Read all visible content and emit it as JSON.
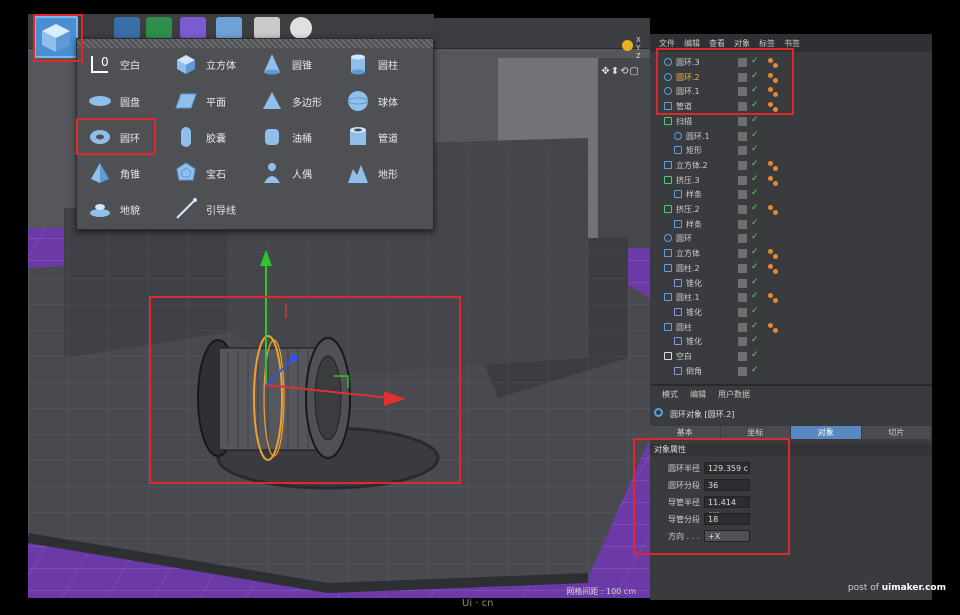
{
  "popup": {
    "items": [
      {
        "label": "空白",
        "icon": "null-icon"
      },
      {
        "label": "立方体",
        "icon": "cube-icon"
      },
      {
        "label": "圆锥",
        "icon": "cone-icon"
      },
      {
        "label": "圆柱",
        "icon": "cylinder-icon"
      },
      {
        "label": "圆盘",
        "icon": "disc-icon"
      },
      {
        "label": "平面",
        "icon": "plane-icon"
      },
      {
        "label": "多边形",
        "icon": "polygon-icon"
      },
      {
        "label": "球体",
        "icon": "sphere-icon"
      },
      {
        "label": "圆环",
        "icon": "torus-icon"
      },
      {
        "label": "胶囊",
        "icon": "capsule-icon"
      },
      {
        "label": "油桶",
        "icon": "oiltank-icon"
      },
      {
        "label": "管道",
        "icon": "tube-icon"
      },
      {
        "label": "角锥",
        "icon": "pyramid-icon"
      },
      {
        "label": "宝石",
        "icon": "platonic-icon"
      },
      {
        "label": "人偶",
        "icon": "figure-icon"
      },
      {
        "label": "地形",
        "icon": "landscape-icon"
      },
      {
        "label": "地貌",
        "icon": "relief-icon"
      },
      {
        "label": "引导线",
        "icon": "guide-icon"
      }
    ]
  },
  "object_manager": {
    "menu": [
      "文件",
      "编辑",
      "查看",
      "对象",
      "标签",
      "书签"
    ],
    "xyz": [
      "X",
      "Y",
      "Z"
    ],
    "rows": [
      {
        "name": "圆环.3",
        "indent": 0,
        "icon": "torus-icon",
        "highlight": false,
        "balls": 1
      },
      {
        "name": "圆环.2",
        "indent": 0,
        "icon": "torus-icon",
        "highlight": true,
        "balls": 1
      },
      {
        "name": "圆环.1",
        "indent": 0,
        "icon": "torus-icon",
        "highlight": false,
        "balls": 1
      },
      {
        "name": "管道",
        "indent": 0,
        "icon": "tube-icon",
        "highlight": false,
        "balls": 1
      },
      {
        "name": "扫描",
        "indent": 0,
        "icon": "sweep-icon",
        "highlight": false,
        "balls": 0
      },
      {
        "name": "圆环.1",
        "indent": 1,
        "icon": "circle-icon",
        "highlight": false,
        "balls": 0
      },
      {
        "name": "矩形",
        "indent": 1,
        "icon": "rectangle-icon",
        "highlight": false,
        "balls": 0
      },
      {
        "name": "立方体.2",
        "indent": 0,
        "icon": "cube-icon",
        "highlight": false,
        "balls": 1
      },
      {
        "name": "挤压.3",
        "indent": 0,
        "icon": "extrude-icon",
        "highlight": false,
        "balls": 1
      },
      {
        "name": "样条",
        "indent": 1,
        "icon": "spline-icon",
        "highlight": false,
        "balls": 0
      },
      {
        "name": "挤压.2",
        "indent": 0,
        "icon": "extrude-icon",
        "highlight": false,
        "balls": 1
      },
      {
        "name": "样条",
        "indent": 1,
        "icon": "spline-icon",
        "highlight": false,
        "balls": 0
      },
      {
        "name": "圆环",
        "indent": 0,
        "icon": "circle-icon",
        "highlight": false,
        "balls": 0
      },
      {
        "name": "立方体",
        "indent": 0,
        "icon": "cube-icon",
        "highlight": false,
        "balls": 1
      },
      {
        "name": "圆柱.2",
        "indent": 0,
        "icon": "cylinder-icon",
        "highlight": false,
        "balls": 1
      },
      {
        "name": "锥化",
        "indent": 1,
        "icon": "taper-icon",
        "highlight": false,
        "balls": 0
      },
      {
        "name": "圆柱.1",
        "indent": 0,
        "icon": "cylinder-icon",
        "highlight": false,
        "balls": 1
      },
      {
        "name": "锥化",
        "indent": 1,
        "icon": "taper-icon",
        "highlight": false,
        "balls": 0
      },
      {
        "name": "圆柱",
        "indent": 0,
        "icon": "cylinder-icon",
        "highlight": false,
        "balls": 1
      },
      {
        "name": "锥化",
        "indent": 1,
        "icon": "taper-icon",
        "highlight": false,
        "balls": 0
      },
      {
        "name": "空白",
        "indent": 0,
        "icon": "null-icon",
        "highlight": false,
        "balls": 0
      },
      {
        "name": "倒角",
        "indent": 1,
        "icon": "bevel-icon",
        "highlight": false,
        "balls": 0
      }
    ]
  },
  "attributes": {
    "menu": [
      "模式",
      "编辑",
      "用户数据"
    ],
    "object_title": "圆环对象 [圆环.2]",
    "tabs": [
      "基本",
      "坐标",
      "对象",
      "切片"
    ],
    "active_tab": 2,
    "section": "对象属性",
    "fields": [
      {
        "label": "圆环半径",
        "value": "129.359 c"
      },
      {
        "label": "圆环分段",
        "value": "36"
      },
      {
        "label": "导管半径",
        "value": "11.414 cm"
      },
      {
        "label": "导管分段",
        "value": "18"
      },
      {
        "label": "方向 . . .",
        "value": "+X"
      }
    ]
  },
  "viewport": {
    "grid_readout": "网格间距 : 100 cm",
    "nav_icons": "✥⬍⟲▢"
  },
  "credit": {
    "prefix": "post of ",
    "site": "uimaker.com"
  },
  "watermark": "Ui · cn"
}
